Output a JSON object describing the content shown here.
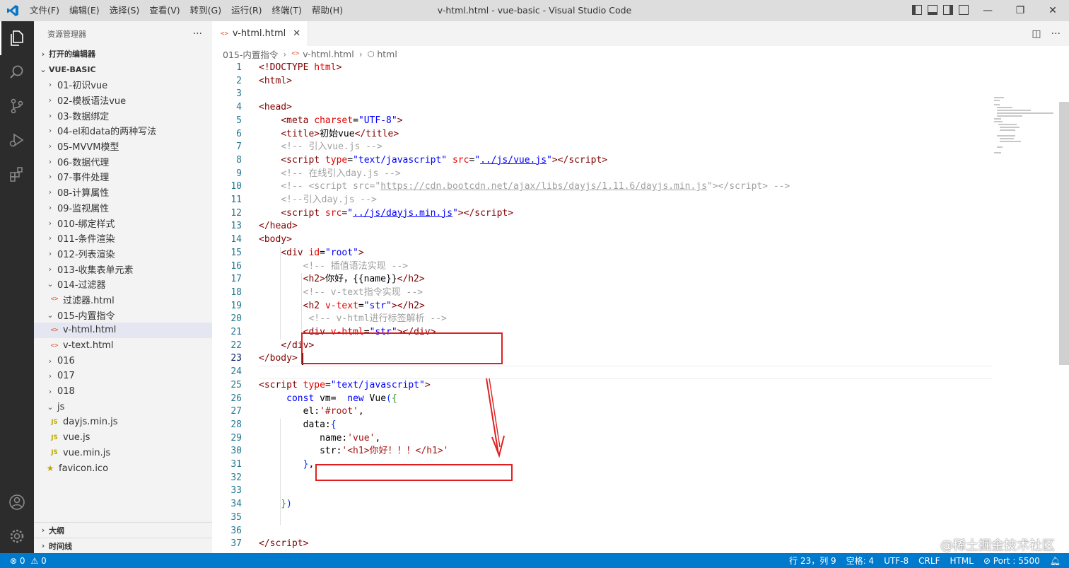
{
  "window": {
    "title": "v-html.html - vue-basic - Visual Studio Code",
    "menu": [
      "文件(F)",
      "编辑(E)",
      "选择(S)",
      "查看(V)",
      "转到(G)",
      "运行(R)",
      "终端(T)",
      "帮助(H)"
    ],
    "controls": {
      "minimize": "—",
      "restore": "❐",
      "close": "✕"
    }
  },
  "activity_bar": {
    "top": [
      "explorer-icon",
      "search-icon",
      "source-control-icon",
      "run-debug-icon",
      "extensions-icon"
    ],
    "bottom": [
      "account-icon",
      "settings-gear-icon"
    ]
  },
  "sidebar": {
    "title": "资源管理器",
    "more": "···",
    "open_editors": "打开的编辑器",
    "project": "VUE-BASIC",
    "tree": [
      {
        "label": "01-初识vue",
        "type": "folder",
        "open": false,
        "depth": 1
      },
      {
        "label": "02-模板语法vue",
        "type": "folder",
        "open": false,
        "depth": 1
      },
      {
        "label": "03-数据绑定",
        "type": "folder",
        "open": false,
        "depth": 1
      },
      {
        "label": "04-el和data的两种写法",
        "type": "folder",
        "open": false,
        "depth": 1
      },
      {
        "label": "05-MVVM模型",
        "type": "folder",
        "open": false,
        "depth": 1
      },
      {
        "label": "06-数据代理",
        "type": "folder",
        "open": false,
        "depth": 1
      },
      {
        "label": "07-事件处理",
        "type": "folder",
        "open": false,
        "depth": 1
      },
      {
        "label": "08-计算属性",
        "type": "folder",
        "open": false,
        "depth": 1
      },
      {
        "label": "09-监视属性",
        "type": "folder",
        "open": false,
        "depth": 1
      },
      {
        "label": "010-绑定样式",
        "type": "folder",
        "open": false,
        "depth": 1
      },
      {
        "label": "011-条件渲染",
        "type": "folder",
        "open": false,
        "depth": 1
      },
      {
        "label": "012-列表渲染",
        "type": "folder",
        "open": false,
        "depth": 1
      },
      {
        "label": "013-收集表单元素",
        "type": "folder",
        "open": false,
        "depth": 1
      },
      {
        "label": "014-过滤器",
        "type": "folder",
        "open": true,
        "depth": 1
      },
      {
        "label": "过滤器.html",
        "type": "html",
        "depth": 2
      },
      {
        "label": "015-内置指令",
        "type": "folder",
        "open": true,
        "depth": 1
      },
      {
        "label": "v-html.html",
        "type": "html",
        "depth": 2,
        "selected": true
      },
      {
        "label": "v-text.html",
        "type": "html",
        "depth": 2
      },
      {
        "label": "016",
        "type": "folder",
        "open": false,
        "depth": 1
      },
      {
        "label": "017",
        "type": "folder",
        "open": false,
        "depth": 1
      },
      {
        "label": "018",
        "type": "folder",
        "open": false,
        "depth": 1
      },
      {
        "label": "js",
        "type": "folder",
        "open": true,
        "depth": 1
      },
      {
        "label": "dayjs.min.js",
        "type": "js",
        "depth": 2
      },
      {
        "label": "vue.js",
        "type": "js",
        "depth": 2
      },
      {
        "label": "vue.min.js",
        "type": "js",
        "depth": 2
      },
      {
        "label": "favicon.ico",
        "type": "ico",
        "depth": 1
      }
    ],
    "outline": "大纲",
    "timeline": "时间线"
  },
  "editor": {
    "tab_label": "v-html.html",
    "tab_close": "✕",
    "breadcrumb": [
      "015-内置指令",
      "v-html.html",
      "html"
    ],
    "line_numbers": [
      "1",
      "2",
      "3",
      "4",
      "5",
      "6",
      "7",
      "8",
      "9",
      "10",
      "11",
      "12",
      "13",
      "14",
      "15",
      "16",
      "17",
      "18",
      "19",
      "20",
      "21",
      "22",
      "23",
      "24",
      "25",
      "26",
      "27",
      "28",
      "29",
      "30",
      "31",
      "32",
      "33",
      "34",
      "35",
      "36",
      "37"
    ],
    "current_line": "23"
  },
  "statusbar": {
    "errors": "⊗ 0",
    "warnings": "⚠ 0",
    "position": "行 23，列 9",
    "spaces": "空格: 4",
    "encoding": "UTF-8",
    "eol": "CRLF",
    "language": "HTML",
    "port": "⊘ Port : 5500"
  },
  "watermark": "@稀土掘金技术社区",
  "colors": {
    "activity_bar": "#2c2c2c",
    "sidebar": "#f3f3f3",
    "statusbar": "#007acc",
    "annotation": "#e02020"
  }
}
